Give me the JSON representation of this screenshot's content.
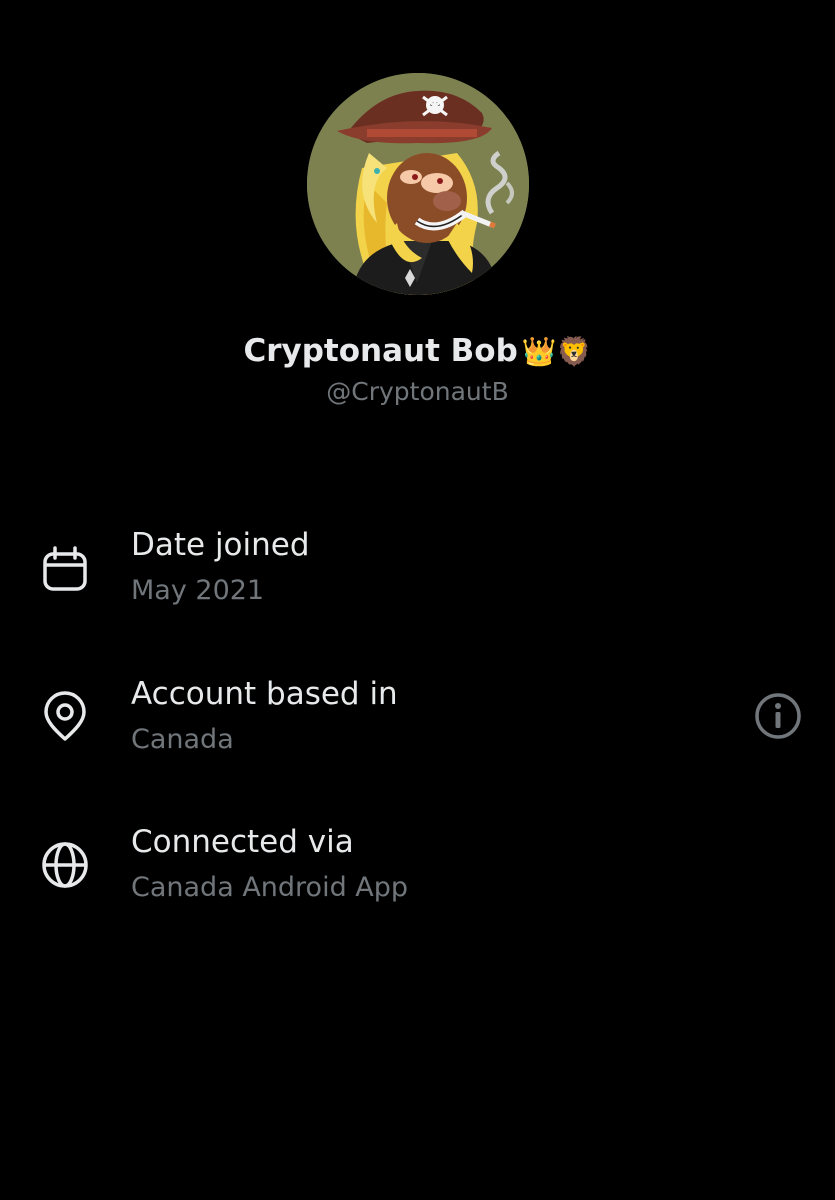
{
  "profile": {
    "display_name": "Cryptonaut Bob",
    "badges": "👑🦁",
    "handle": "@CryptonautB",
    "avatar_icon": "pirate-lion-avatar"
  },
  "details": {
    "date_joined": {
      "label": "Date joined",
      "value": "May 2021",
      "icon": "calendar-icon"
    },
    "account_based_in": {
      "label": "Account based in",
      "value": "Canada",
      "icon": "location-pin-icon",
      "info_icon": "info-icon"
    },
    "connected_via": {
      "label": "Connected via",
      "value": "Canada Android App",
      "icon": "globe-icon"
    }
  },
  "colors": {
    "background": "#000000",
    "primary_text": "#e7e9ea",
    "secondary_text": "#71767b",
    "avatar_bg": "#7d8150"
  }
}
